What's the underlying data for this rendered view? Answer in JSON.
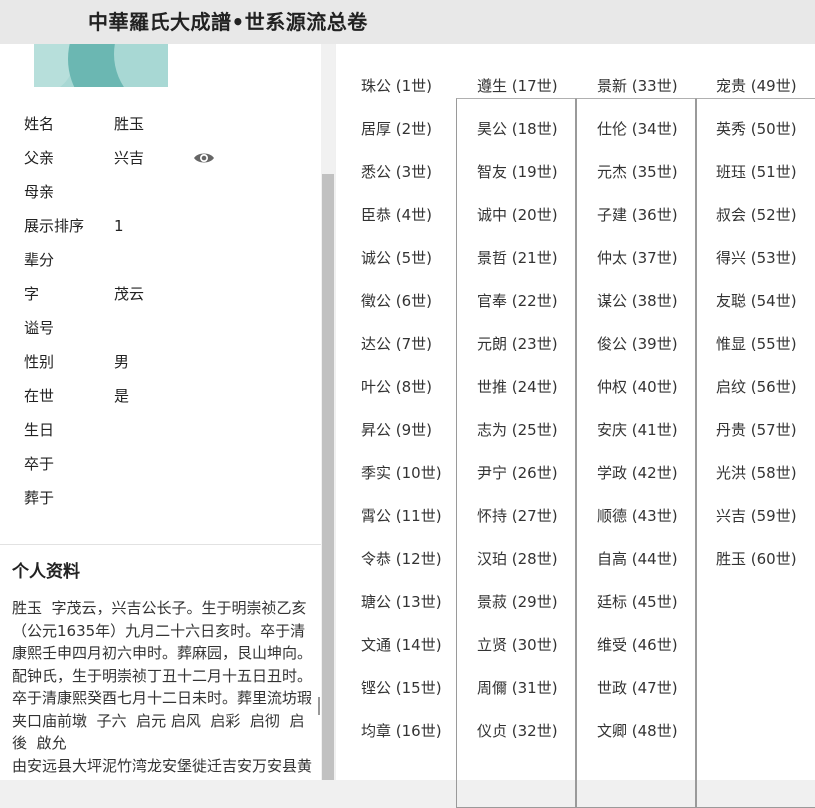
{
  "header": {
    "title": "中華羅氏大成譜•世系源流总卷"
  },
  "person": {
    "fields": [
      {
        "label": "姓名",
        "value": "胜玉"
      },
      {
        "label": "父亲",
        "value": "兴吉"
      },
      {
        "label": "母亲",
        "value": ""
      },
      {
        "label": "展示排序",
        "value": "1"
      },
      {
        "label": "辈分",
        "value": ""
      },
      {
        "label": "字",
        "value": "茂云"
      },
      {
        "label": "谥号",
        "value": ""
      },
      {
        "label": "性别",
        "value": "男"
      },
      {
        "label": "在世",
        "value": "是"
      },
      {
        "label": "生日",
        "value": ""
      },
      {
        "label": "卒于",
        "value": ""
      },
      {
        "label": "葬于",
        "value": ""
      }
    ],
    "eye_icon": "eye-icon"
  },
  "profile": {
    "title": "个人资料",
    "bio": "胜玉  字茂云，兴吉公长子。生于明崇祯乙亥（公元1635年）九月二十六日亥时。卒于清康熙壬申四月初六申时。葬麻园，艮山坤向。配钟氏，生于明崇祯丁丑十二月十五日丑时。卒于清康熙癸酉七月十二日未时。葬里流坊瑕夹口庙前墩  子六  启元 启风  启彩  启彻  启後  啟允\n由安远县大坪泥竹湾龙安堡徙迁吉安万安县黄塘下禾田开基立业。"
  },
  "lineage": [
    "珠公 (1世)",
    "居厚 (2世)",
    "悉公 (3世)",
    "臣恭 (4世)",
    "诚公 (5世)",
    "徵公 (6世)",
    "达公 (7世)",
    "叶公 (8世)",
    "昇公 (9世)",
    "季实 (10世)",
    "霄公 (11世)",
    "令恭 (12世)",
    "瑭公 (13世)",
    "文通 (14世)",
    "铿公 (15世)",
    "均章 (16世)",
    "遵生 (17世)",
    "昊公 (18世)",
    "智友 (19世)",
    "诚中 (20世)",
    "景哲 (21世)",
    "官奉 (22世)",
    "元朗 (23世)",
    "世推 (24世)",
    "志为 (25世)",
    "尹宁 (26世)",
    "怀持 (27世)",
    "汉珀 (28世)",
    "景菽 (29世)",
    "立贤 (30世)",
    "周儞 (31世)",
    "仪贞 (32世)",
    "景新 (33世)",
    "仕伦 (34世)",
    "元杰 (35世)",
    "子建 (36世)",
    "仲太 (37世)",
    "谋公 (38世)",
    "俊公 (39世)",
    "仲权 (40世)",
    "安庆 (41世)",
    "学政 (42世)",
    "顺德 (43世)",
    "自高 (44世)",
    "廷标 (45世)",
    "维受 (46世)",
    "世政 (47世)",
    "文卿 (48世)",
    "宠贵 (49世)",
    "英秀 (50世)",
    "班珏 (51世)",
    "叔会 (52世)",
    "得兴 (53世)",
    "友聪 (54世)",
    "惟显 (55世)",
    "启纹 (56世)",
    "丹贵 (57世)",
    "光洪 (58世)",
    "兴吉 (59世)",
    "胜玉 (60世)"
  ]
}
